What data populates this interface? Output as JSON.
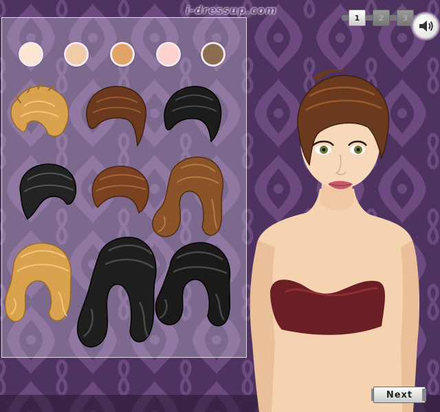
{
  "brand": {
    "text": "i-dressup.com"
  },
  "pagination": {
    "pages": [
      {
        "label": "1",
        "active": true
      },
      {
        "label": "2",
        "active": false
      },
      {
        "label": "3",
        "active": false
      }
    ]
  },
  "sound": {
    "icon": "speaker-icon"
  },
  "skin_tones": [
    {
      "color": "#fbe6d2"
    },
    {
      "color": "#efcba7"
    },
    {
      "color": "#dfa466"
    },
    {
      "color": "#fdd2cd"
    },
    {
      "color": "#8b6d50"
    }
  ],
  "hair_options": [
    {
      "style": "short-messy",
      "color": "#d9a24e"
    },
    {
      "style": "short-bob",
      "color": "#6b3a1e"
    },
    {
      "style": "short-pixie",
      "color": "#1c1c1c"
    },
    {
      "style": "short-swept",
      "color": "#222222"
    },
    {
      "style": "short-wavy",
      "color": "#7a4220"
    },
    {
      "style": "long-wavy",
      "color": "#8a5428"
    },
    {
      "style": "curly-medium",
      "color": "#d9a24e"
    },
    {
      "style": "long-curly",
      "color": "#1e1e1e"
    },
    {
      "style": "long-waves",
      "color": "#1a1a1a"
    }
  ],
  "colors": {
    "background": "#4a2f5a",
    "damask": "#6e4b82",
    "top": "#6b1e24"
  },
  "next_button": {
    "label": "Next"
  }
}
